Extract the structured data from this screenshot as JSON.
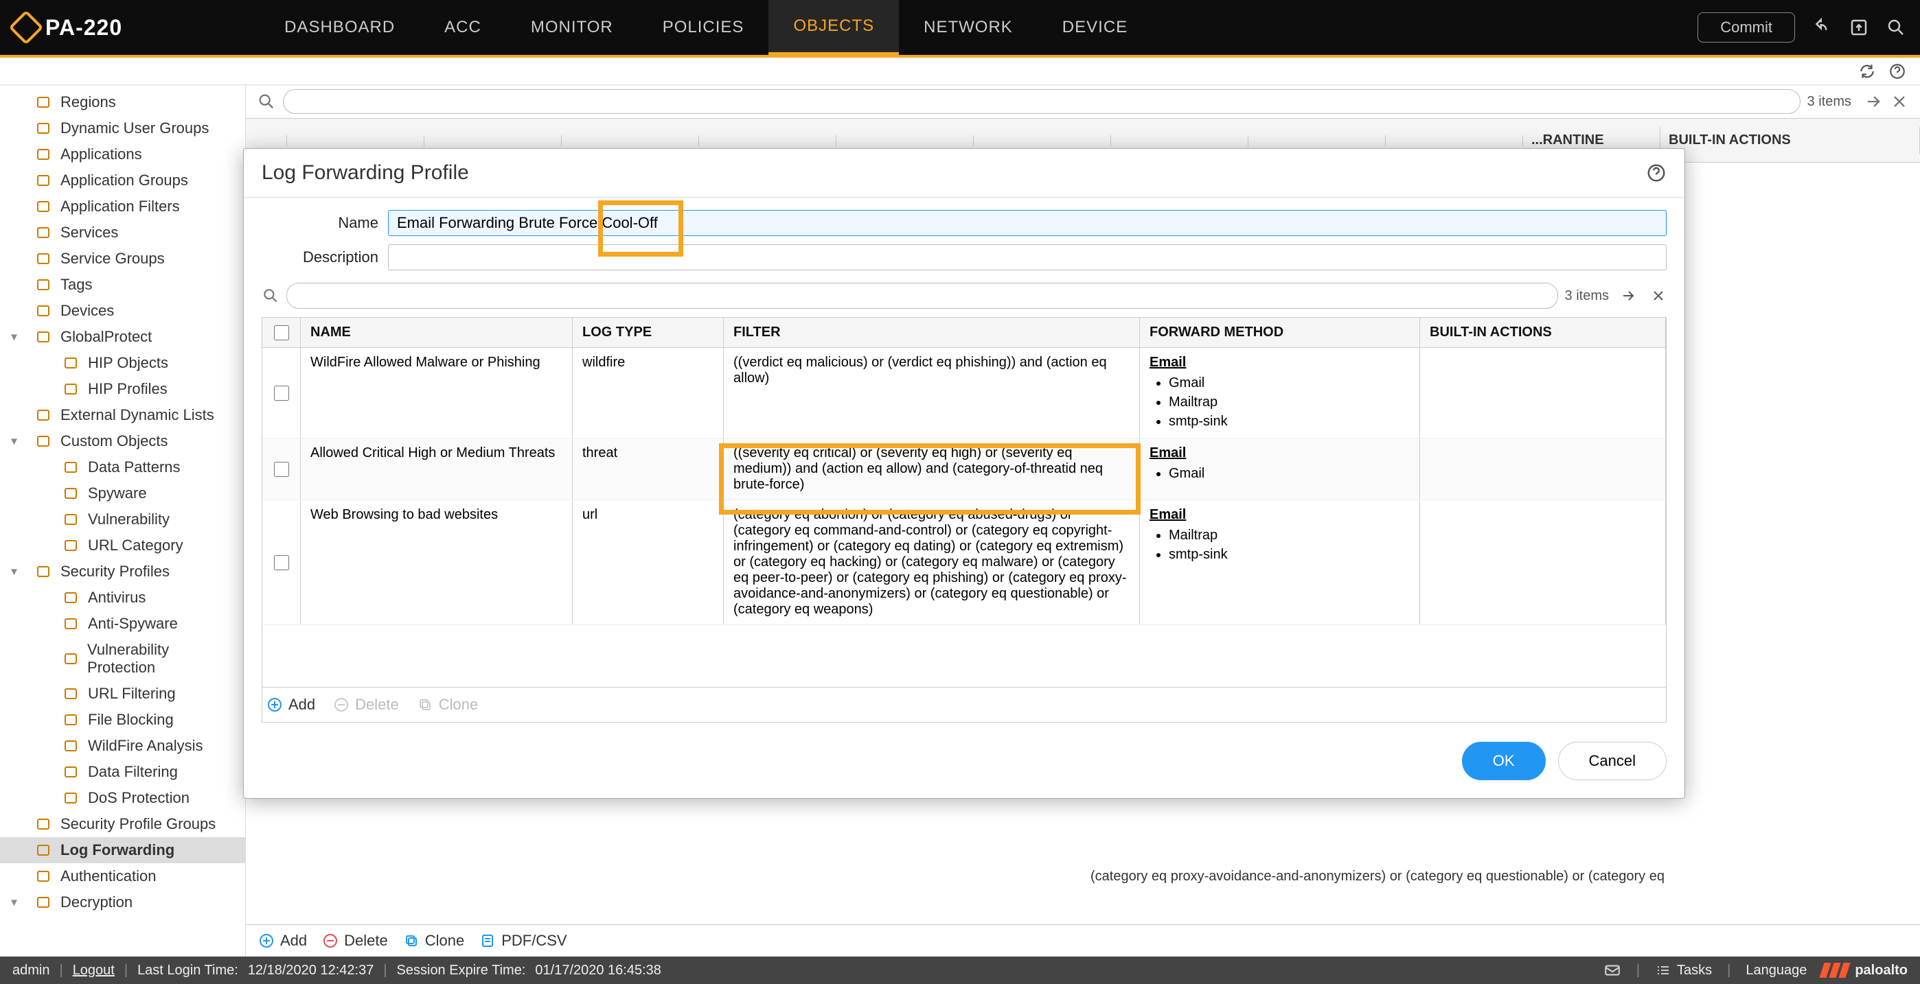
{
  "header": {
    "device": "PA-220",
    "tabs": [
      "DASHBOARD",
      "ACC",
      "MONITOR",
      "POLICIES",
      "OBJECTS",
      "NETWORK",
      "DEVICE"
    ],
    "active_tab": "OBJECTS",
    "commit_label": "Commit"
  },
  "sidebar": {
    "items": [
      {
        "label": "Regions",
        "icon": "globe"
      },
      {
        "label": "Dynamic User Groups",
        "icon": "users"
      },
      {
        "label": "Applications",
        "icon": "window"
      },
      {
        "label": "Application Groups",
        "icon": "window"
      },
      {
        "label": "Application Filters",
        "icon": "window"
      },
      {
        "label": "Services",
        "icon": "gear"
      },
      {
        "label": "Service Groups",
        "icon": "gear"
      },
      {
        "label": "Tags",
        "icon": "tag"
      },
      {
        "label": "Devices",
        "icon": "device"
      },
      {
        "label": "GlobalProtect",
        "icon": "globe",
        "expand": true,
        "chev": "down"
      },
      {
        "label": "HIP Objects",
        "icon": "shield",
        "indent": 1
      },
      {
        "label": "HIP Profiles",
        "icon": "shield",
        "indent": 1
      },
      {
        "label": "External Dynamic Lists",
        "icon": "list"
      },
      {
        "label": "Custom Objects",
        "icon": "folder",
        "expand": true,
        "chev": "down"
      },
      {
        "label": "Data Patterns",
        "icon": "doc",
        "indent": 1
      },
      {
        "label": "Spyware",
        "icon": "spy",
        "indent": 1
      },
      {
        "label": "Vulnerability",
        "icon": "shield",
        "indent": 1
      },
      {
        "label": "URL Category",
        "icon": "url",
        "indent": 1
      },
      {
        "label": "Security Profiles",
        "icon": "folder",
        "expand": true,
        "chev": "down"
      },
      {
        "label": "Antivirus",
        "icon": "shield",
        "indent": 1
      },
      {
        "label": "Anti-Spyware",
        "icon": "shield",
        "indent": 1
      },
      {
        "label": "Vulnerability Protection",
        "icon": "shield",
        "indent": 1
      },
      {
        "label": "URL Filtering",
        "icon": "shield",
        "indent": 1
      },
      {
        "label": "File Blocking",
        "icon": "shield",
        "indent": 1
      },
      {
        "label": "WildFire Analysis",
        "icon": "fire",
        "indent": 1
      },
      {
        "label": "Data Filtering",
        "icon": "shield",
        "indent": 1
      },
      {
        "label": "DoS Protection",
        "icon": "shield",
        "indent": 1
      },
      {
        "label": "Security Profile Groups",
        "icon": "group"
      },
      {
        "label": "Log Forwarding",
        "icon": "forward",
        "selected": true
      },
      {
        "label": "Authentication",
        "icon": "lock"
      },
      {
        "label": "Decryption",
        "icon": "key",
        "expand": true,
        "chev": "down"
      }
    ]
  },
  "content": {
    "items_count": "3 items",
    "columns_right": [
      "...RANTINE",
      "BUILT-IN ACTIONS"
    ],
    "peek_text": "(category eq proxy-avoidance-and-anonymizers) or (category eq questionable) or (category eq",
    "actions": {
      "add": "Add",
      "delete": "Delete",
      "clone": "Clone",
      "pdf": "PDF/CSV"
    }
  },
  "modal": {
    "title": "Log Forwarding Profile",
    "name_label": "Name",
    "name_value": "Email Forwarding Brute Force Cool-Off",
    "desc_label": "Description",
    "desc_value": "",
    "items_count": "3 items",
    "columns": {
      "name": "NAME",
      "logtype": "LOG TYPE",
      "filter": "FILTER",
      "fwd": "FORWARD METHOD",
      "actions": "BUILT-IN ACTIONS"
    },
    "rows": [
      {
        "name": "WildFire Allowed Malware or Phishing",
        "logtype": "wildfire",
        "filter": "((verdict eq malicious) or (verdict eq phishing)) and (action eq allow)",
        "fwd_header": "Email",
        "fwd_items": [
          "Gmail",
          "Mailtrap",
          "smtp-sink"
        ]
      },
      {
        "name": "Allowed Critical High or Medium Threats",
        "logtype": "threat",
        "filter": "((severity eq critical) or (severity eq high) or (severity eq medium)) and (action eq allow) and (category-of-threatid neq brute-force)",
        "fwd_header": "Email",
        "fwd_items": [
          "Gmail"
        ]
      },
      {
        "name": "Web Browsing to bad websites",
        "logtype": "url",
        "filter": "(category eq abortion) or (category eq abused-drugs) or (category eq command-and-control) or (category eq copyright-infringement) or (category eq dating) or (category eq extremism) or (category eq hacking) or (category eq malware) or (category eq peer-to-peer) or (category eq phishing) or (category eq proxy-avoidance-and-anonymizers) or (category eq questionable) or (category eq weapons)",
        "fwd_header": "Email",
        "fwd_items": [
          "Mailtrap",
          "smtp-sink"
        ]
      }
    ],
    "inner_actions": {
      "add": "Add",
      "delete": "Delete",
      "clone": "Clone"
    },
    "ok": "OK",
    "cancel": "Cancel"
  },
  "status": {
    "user": "admin",
    "logout": "Logout",
    "last_login_lbl": "Last Login Time:",
    "last_login": "12/18/2020 12:42:37",
    "session_expire_lbl": "Session Expire Time:",
    "session_expire": "01/17/2020 16:45:38",
    "tasks": "Tasks",
    "language": "Language",
    "brand": "paloalto"
  }
}
